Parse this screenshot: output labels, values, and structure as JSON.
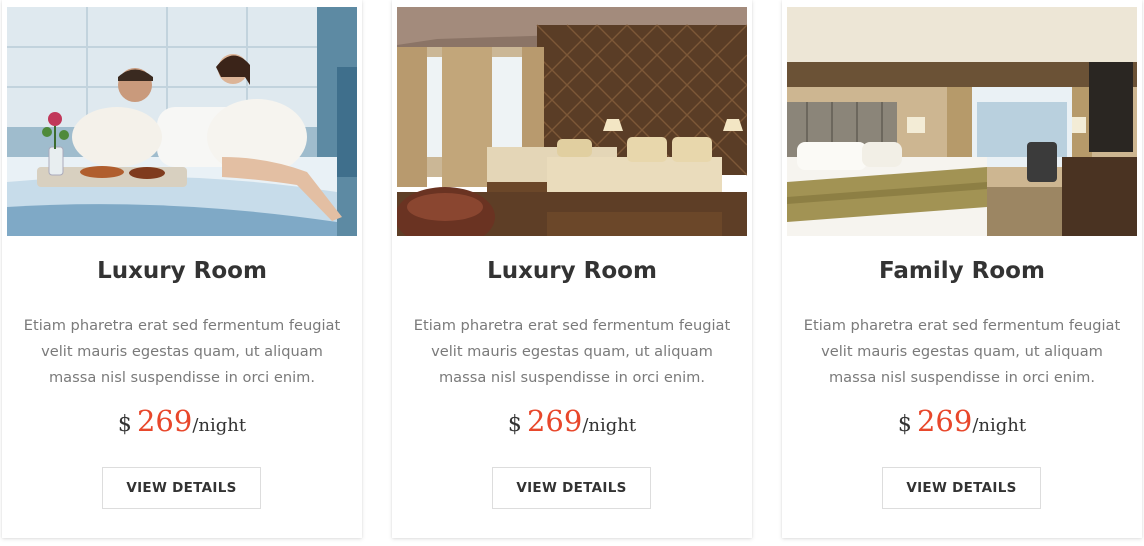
{
  "rooms": [
    {
      "title": "Luxury Room",
      "description": "Etiam pharetra erat sed fermentum feugiat velit mauris egestas quam, ut aliquam massa nisl suspendisse in orci enim.",
      "currency": "$",
      "price": "269",
      "unit": "/night",
      "button_label": "VIEW DETAILS",
      "image": "couple-breakfast-in-bed-photo"
    },
    {
      "title": "Luxury Room",
      "description": "Etiam pharetra erat sed fermentum feugiat velit mauris egestas quam, ut aliquam massa nisl suspendisse in orci enim.",
      "currency": "$",
      "price": "269",
      "unit": "/night",
      "button_label": "VIEW DETAILS",
      "image": "tufted-wall-two-beds-photo"
    },
    {
      "title": "Family Room",
      "description": "Etiam pharetra erat sed fermentum feugiat velit mauris egestas quam, ut aliquam massa nisl suspendisse in orci enim.",
      "currency": "$",
      "price": "269",
      "unit": "/night",
      "button_label": "VIEW DETAILS",
      "image": "hotel-room-king-bed-photo"
    }
  ],
  "colors": {
    "accent": "#e8472b",
    "heading": "#333333",
    "body_text": "#7a7a7a",
    "button_border": "#dddddd"
  }
}
